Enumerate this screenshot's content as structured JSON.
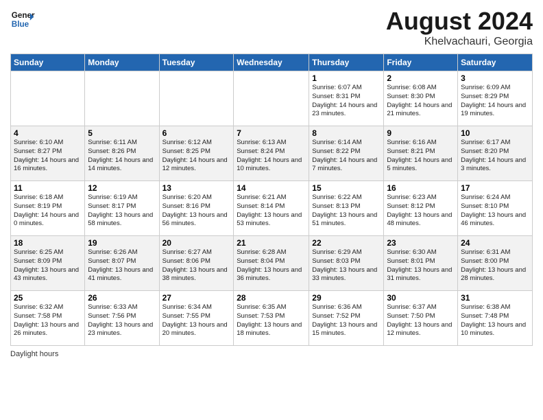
{
  "header": {
    "logo_general": "General",
    "logo_blue": "Blue",
    "month_year": "August 2024",
    "location": "Khelvachauri, Georgia"
  },
  "days_of_week": [
    "Sunday",
    "Monday",
    "Tuesday",
    "Wednesday",
    "Thursday",
    "Friday",
    "Saturday"
  ],
  "weeks": [
    [
      {
        "day": "",
        "info": ""
      },
      {
        "day": "",
        "info": ""
      },
      {
        "day": "",
        "info": ""
      },
      {
        "day": "",
        "info": ""
      },
      {
        "day": "1",
        "info": "Sunrise: 6:07 AM\nSunset: 8:31 PM\nDaylight: 14 hours and 23 minutes."
      },
      {
        "day": "2",
        "info": "Sunrise: 6:08 AM\nSunset: 8:30 PM\nDaylight: 14 hours and 21 minutes."
      },
      {
        "day": "3",
        "info": "Sunrise: 6:09 AM\nSunset: 8:29 PM\nDaylight: 14 hours and 19 minutes."
      }
    ],
    [
      {
        "day": "4",
        "info": "Sunrise: 6:10 AM\nSunset: 8:27 PM\nDaylight: 14 hours and 16 minutes."
      },
      {
        "day": "5",
        "info": "Sunrise: 6:11 AM\nSunset: 8:26 PM\nDaylight: 14 hours and 14 minutes."
      },
      {
        "day": "6",
        "info": "Sunrise: 6:12 AM\nSunset: 8:25 PM\nDaylight: 14 hours and 12 minutes."
      },
      {
        "day": "7",
        "info": "Sunrise: 6:13 AM\nSunset: 8:24 PM\nDaylight: 14 hours and 10 minutes."
      },
      {
        "day": "8",
        "info": "Sunrise: 6:14 AM\nSunset: 8:22 PM\nDaylight: 14 hours and 7 minutes."
      },
      {
        "day": "9",
        "info": "Sunrise: 6:16 AM\nSunset: 8:21 PM\nDaylight: 14 hours and 5 minutes."
      },
      {
        "day": "10",
        "info": "Sunrise: 6:17 AM\nSunset: 8:20 PM\nDaylight: 14 hours and 3 minutes."
      }
    ],
    [
      {
        "day": "11",
        "info": "Sunrise: 6:18 AM\nSunset: 8:19 PM\nDaylight: 14 hours and 0 minutes."
      },
      {
        "day": "12",
        "info": "Sunrise: 6:19 AM\nSunset: 8:17 PM\nDaylight: 13 hours and 58 minutes."
      },
      {
        "day": "13",
        "info": "Sunrise: 6:20 AM\nSunset: 8:16 PM\nDaylight: 13 hours and 56 minutes."
      },
      {
        "day": "14",
        "info": "Sunrise: 6:21 AM\nSunset: 8:14 PM\nDaylight: 13 hours and 53 minutes."
      },
      {
        "day": "15",
        "info": "Sunrise: 6:22 AM\nSunset: 8:13 PM\nDaylight: 13 hours and 51 minutes."
      },
      {
        "day": "16",
        "info": "Sunrise: 6:23 AM\nSunset: 8:12 PM\nDaylight: 13 hours and 48 minutes."
      },
      {
        "day": "17",
        "info": "Sunrise: 6:24 AM\nSunset: 8:10 PM\nDaylight: 13 hours and 46 minutes."
      }
    ],
    [
      {
        "day": "18",
        "info": "Sunrise: 6:25 AM\nSunset: 8:09 PM\nDaylight: 13 hours and 43 minutes."
      },
      {
        "day": "19",
        "info": "Sunrise: 6:26 AM\nSunset: 8:07 PM\nDaylight: 13 hours and 41 minutes."
      },
      {
        "day": "20",
        "info": "Sunrise: 6:27 AM\nSunset: 8:06 PM\nDaylight: 13 hours and 38 minutes."
      },
      {
        "day": "21",
        "info": "Sunrise: 6:28 AM\nSunset: 8:04 PM\nDaylight: 13 hours and 36 minutes."
      },
      {
        "day": "22",
        "info": "Sunrise: 6:29 AM\nSunset: 8:03 PM\nDaylight: 13 hours and 33 minutes."
      },
      {
        "day": "23",
        "info": "Sunrise: 6:30 AM\nSunset: 8:01 PM\nDaylight: 13 hours and 31 minutes."
      },
      {
        "day": "24",
        "info": "Sunrise: 6:31 AM\nSunset: 8:00 PM\nDaylight: 13 hours and 28 minutes."
      }
    ],
    [
      {
        "day": "25",
        "info": "Sunrise: 6:32 AM\nSunset: 7:58 PM\nDaylight: 13 hours and 26 minutes."
      },
      {
        "day": "26",
        "info": "Sunrise: 6:33 AM\nSunset: 7:56 PM\nDaylight: 13 hours and 23 minutes."
      },
      {
        "day": "27",
        "info": "Sunrise: 6:34 AM\nSunset: 7:55 PM\nDaylight: 13 hours and 20 minutes."
      },
      {
        "day": "28",
        "info": "Sunrise: 6:35 AM\nSunset: 7:53 PM\nDaylight: 13 hours and 18 minutes."
      },
      {
        "day": "29",
        "info": "Sunrise: 6:36 AM\nSunset: 7:52 PM\nDaylight: 13 hours and 15 minutes."
      },
      {
        "day": "30",
        "info": "Sunrise: 6:37 AM\nSunset: 7:50 PM\nDaylight: 13 hours and 12 minutes."
      },
      {
        "day": "31",
        "info": "Sunrise: 6:38 AM\nSunset: 7:48 PM\nDaylight: 13 hours and 10 minutes."
      }
    ]
  ],
  "footer": {
    "label": "Daylight hours"
  }
}
